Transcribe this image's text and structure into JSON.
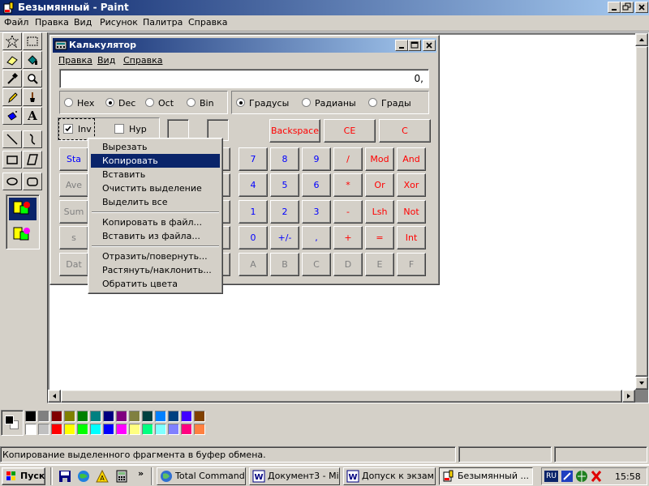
{
  "paint": {
    "title": "Безымянный - Paint",
    "menu": [
      "Файл",
      "Правка",
      "Вид",
      "Рисунок",
      "Палитра",
      "Справка"
    ],
    "status_text": "Копирование выделенного фрагмента в буфер обмена."
  },
  "calculator": {
    "title": "Калькулятор",
    "menu": [
      "Правка",
      "Вид",
      "Справка"
    ],
    "display": "0,",
    "bases": [
      "Hex",
      "Dec",
      "Oct",
      "Bin"
    ],
    "base_selected": "Dec",
    "angles": [
      "Градусы",
      "Радианы",
      "Грады"
    ],
    "angle_selected": "Градусы",
    "inv_label": "Inv",
    "inv_checked": true,
    "hyp_label": "Hyp",
    "hyp_checked": false,
    "backspace": "Backspace",
    "ce": "CE",
    "c": "C",
    "stat_buttons": [
      "Sta",
      "Ave",
      "Sum",
      "s",
      "Dat"
    ],
    "digit_rows": [
      [
        "7",
        "8",
        "9",
        "/",
        "Mod",
        "And"
      ],
      [
        "4",
        "5",
        "6",
        "*",
        "Or",
        "Xor"
      ],
      [
        "1",
        "2",
        "3",
        "-",
        "Lsh",
        "Not"
      ],
      [
        "0",
        "+/-",
        ",",
        "+",
        "=",
        "Int"
      ],
      [
        "A",
        "B",
        "C",
        "D",
        "E",
        "F"
      ]
    ]
  },
  "context_menu": {
    "items": [
      "Вырезать",
      "Копировать",
      "Вставить",
      "Очистить выделение",
      "Выделить все",
      "Копировать в файл...",
      "Вставить из файла...",
      "Отразить/повернуть...",
      "Растянуть/наклонить...",
      "Обратить цвета"
    ],
    "selected": "Копировать"
  },
  "palette": {
    "fg": "#000000",
    "bg": "#ffffff",
    "colors_top": [
      "#000000",
      "#808080",
      "#800000",
      "#808000",
      "#008000",
      "#008080",
      "#000080",
      "#800080",
      "#808040",
      "#004040",
      "#0080ff",
      "#004080",
      "#4000ff",
      "#804000"
    ],
    "colors_bottom": [
      "#ffffff",
      "#c0c0c0",
      "#ff0000",
      "#ffff00",
      "#00ff00",
      "#00ffff",
      "#0000ff",
      "#ff00ff",
      "#ffff80",
      "#00ff80",
      "#80ffff",
      "#8080ff",
      "#ff0080",
      "#ff8040"
    ]
  },
  "taskbar": {
    "start": "Пуск",
    "tasks": [
      "Total Command...",
      "Документ3 - Mi...",
      "Допуск к экзам...",
      "Безымянный ..."
    ],
    "active_task": "Безымянный ...",
    "lang": "RU",
    "clock": "15:58"
  }
}
